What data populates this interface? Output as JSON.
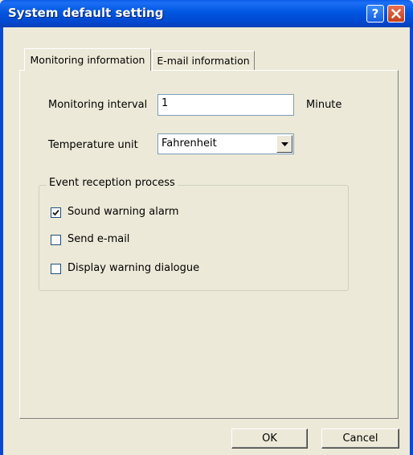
{
  "window": {
    "title": "System default setting",
    "help_glyph": "?",
    "close_icon": "close-icon"
  },
  "tabs": [
    {
      "label": "Monitoring information",
      "active": true
    },
    {
      "label": "E-mail information",
      "active": false
    }
  ],
  "monitoring": {
    "interval_label": "Monitoring interval",
    "interval_value": "1",
    "interval_unit": "Minute",
    "temp_label": "Temperature unit",
    "temp_value": "Fahrenheit"
  },
  "event_group": {
    "legend": "Event reception process",
    "options": [
      {
        "label": "Sound warning alarm",
        "checked": true
      },
      {
        "label": "Send e-mail",
        "checked": false
      },
      {
        "label": "Display warning dialogue",
        "checked": false
      }
    ]
  },
  "buttons": {
    "ok": "OK",
    "cancel": "Cancel"
  },
  "colors": {
    "titlebar": "#0054e3",
    "dialog_bg": "#ece9d8",
    "close_button": "#d54e2c"
  }
}
